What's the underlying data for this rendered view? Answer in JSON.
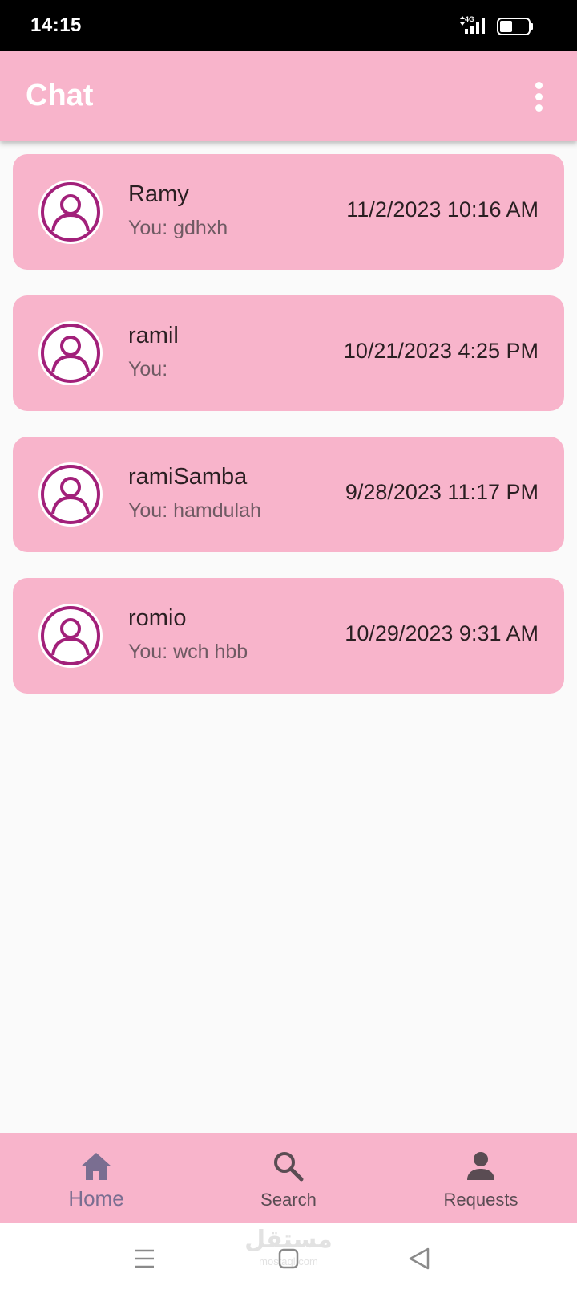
{
  "status_bar": {
    "time": "14:15",
    "network": "4G",
    "battery_level": 0.45
  },
  "app_bar": {
    "title": "Chat",
    "menu_icon": "more-vert-icon"
  },
  "chats": [
    {
      "name": "Ramy",
      "preview": "You: gdhxh",
      "time": "11/2/2023 10:16 AM"
    },
    {
      "name": "ramil",
      "preview": "You:",
      "time": "10/21/2023 4:25 PM"
    },
    {
      "name": "ramiSamba",
      "preview": "You: hamdulah",
      "time": "9/28/2023 11:17 PM"
    },
    {
      "name": "romio",
      "preview": "You: wch hbb",
      "time": "10/29/2023 9:31 AM"
    }
  ],
  "bottom_nav": {
    "items": [
      {
        "label": "Home",
        "icon": "home-icon",
        "active": true
      },
      {
        "label": "Search",
        "icon": "search-icon",
        "active": false
      },
      {
        "label": "Requests",
        "icon": "person-icon",
        "active": false
      }
    ]
  },
  "system_nav": {
    "watermark": "مستقل",
    "watermark_sub": "mostaql.com"
  },
  "colors": {
    "primary": "#f8b4cb",
    "avatar_accent": "#a2207a",
    "active_nav": "#7a6e91"
  }
}
